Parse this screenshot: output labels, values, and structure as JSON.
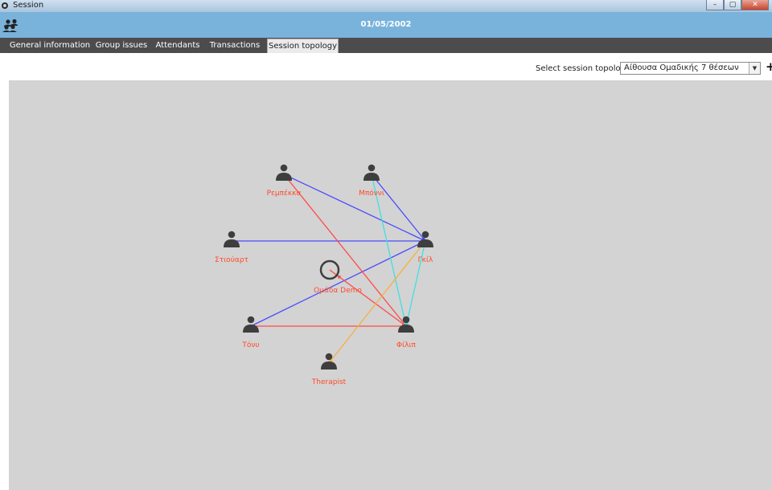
{
  "window": {
    "title": "Session"
  },
  "window_buttons": {
    "minimize": "–",
    "maximize": "▢",
    "close": "✕"
  },
  "header": {
    "date": "01/05/2002"
  },
  "tabs": [
    {
      "label": "General information",
      "active": false
    },
    {
      "label": "Group issues",
      "active": false
    },
    {
      "label": "Attendants",
      "active": false
    },
    {
      "label": "Transactions",
      "active": false
    },
    {
      "label": "Session topology",
      "active": true
    }
  ],
  "toolbar": {
    "select_label": "Select session topology",
    "select_value": "Αίθουσα Ομαδικής 7 θέσεων",
    "add_label": "+"
  },
  "topology": {
    "group": {
      "label": "Ομάδα Demo"
    },
    "people": [
      {
        "id": "rebecca",
        "label": "Ρεμπέκκα"
      },
      {
        "id": "bonnie",
        "label": "Μπόννι"
      },
      {
        "id": "stuart",
        "label": "Στιούαρτ"
      },
      {
        "id": "gil",
        "label": "Γκίλ"
      },
      {
        "id": "tony",
        "label": "Τόνυ"
      },
      {
        "id": "philip",
        "label": "Φίλιπ"
      },
      {
        "id": "therapist",
        "label": "Therapist"
      }
    ],
    "links": [
      {
        "from": "rebecca",
        "to": "gil",
        "color": "#4a4aff"
      },
      {
        "from": "bonnie",
        "to": "gil",
        "color": "#4a4aff"
      },
      {
        "from": "stuart",
        "to": "gil",
        "color": "#4a4aff"
      },
      {
        "from": "tony",
        "to": "gil",
        "color": "#4a4aff"
      },
      {
        "from": "philip",
        "to": "rebecca",
        "color": "#ff4a4a"
      },
      {
        "from": "philip",
        "to": "group",
        "color": "#ff4a4a"
      },
      {
        "from": "tony",
        "to": "philip",
        "color": "#ff4a4a"
      },
      {
        "from": "bonnie",
        "to": "philip",
        "color": "#40e0e0"
      },
      {
        "from": "gil",
        "to": "philip",
        "color": "#40e0e0"
      },
      {
        "from": "gil",
        "to": "therapist",
        "color": "#f5b040"
      }
    ]
  },
  "colors": {
    "header_blue": "#79b3dc",
    "tab_bar": "#4c4c4c",
    "canvas_bg": "#d3d3d3",
    "person_icon": "#3e3e3e",
    "label_text": "#ff4a2a"
  }
}
